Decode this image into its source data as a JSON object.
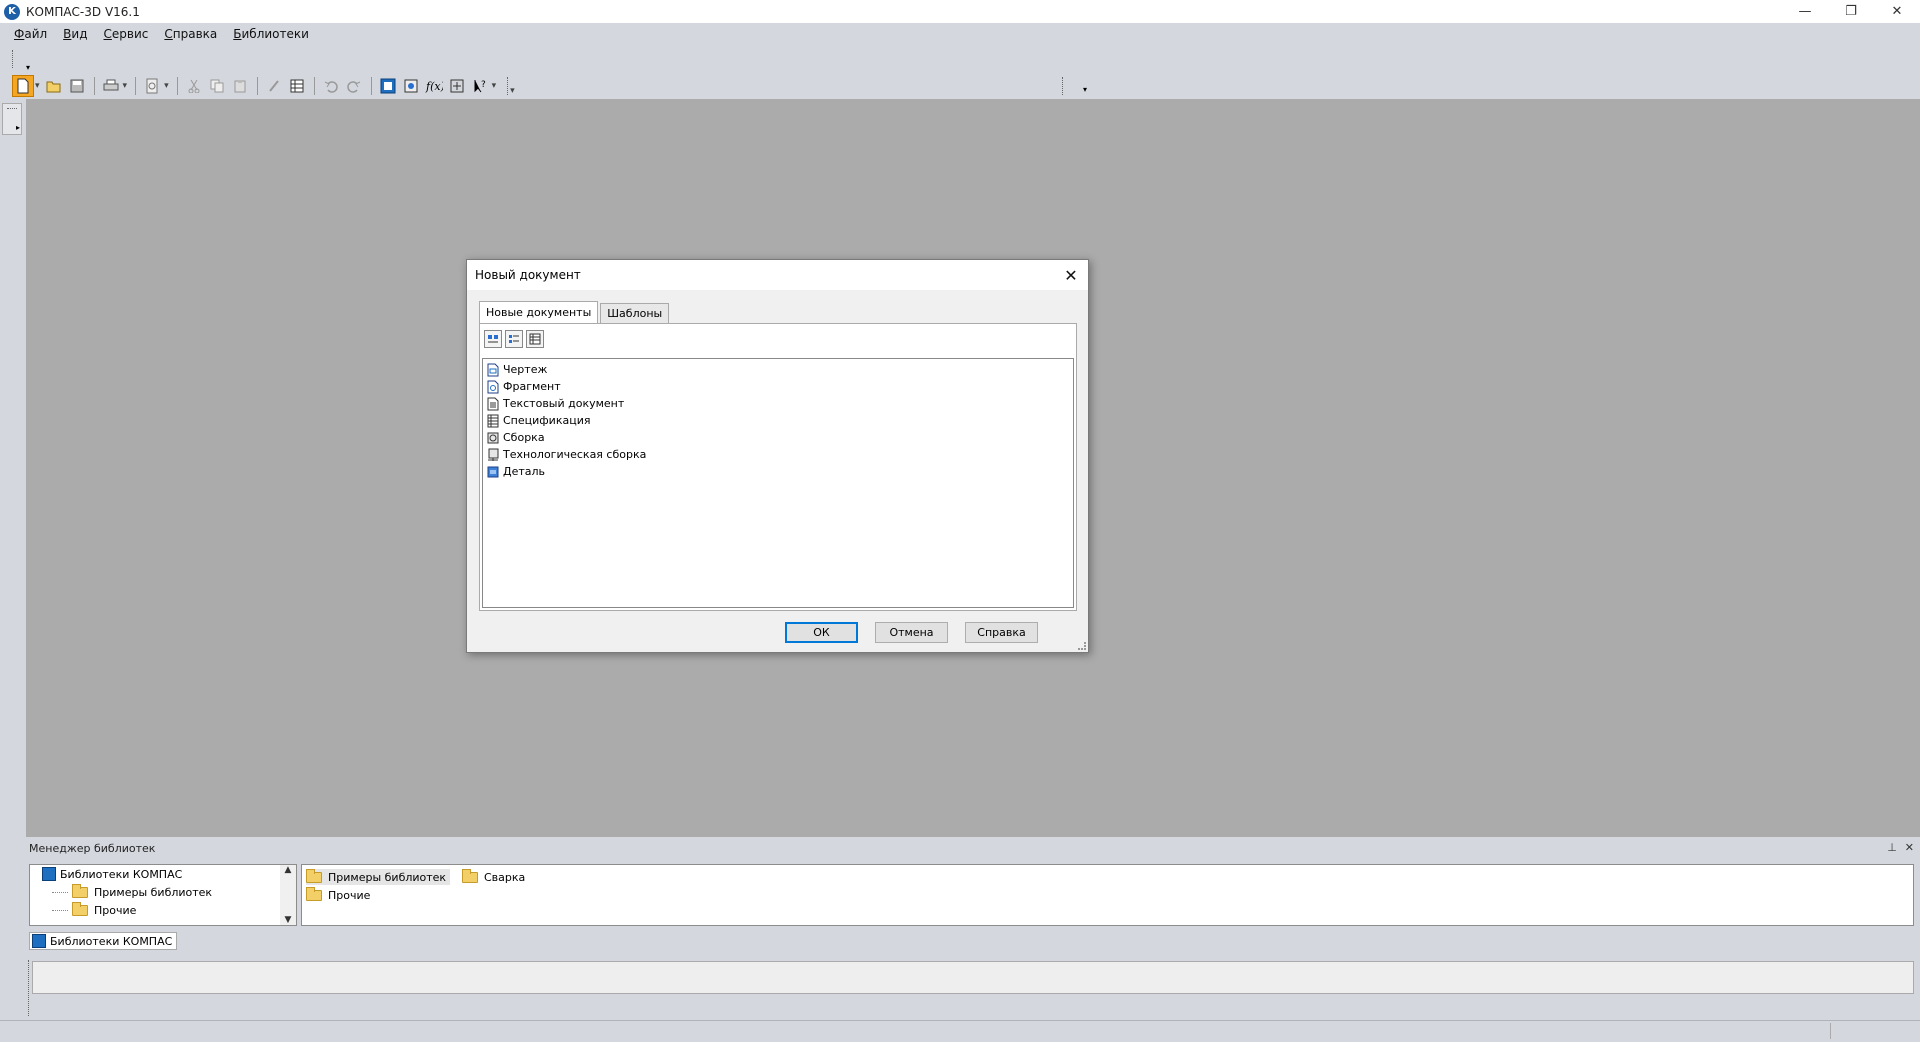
{
  "app": {
    "title": "КОМПАС-3D V16.1",
    "logo_letter": "K"
  },
  "window_controls": {
    "minimize": "—",
    "restore": "❐",
    "close": "✕"
  },
  "menu": [
    "Файл",
    "Вид",
    "Сервис",
    "Справка",
    "Библиотеки"
  ],
  "dialog": {
    "title": "Новый документ",
    "close": "✕",
    "tabs": [
      "Новые документы",
      "Шаблоны"
    ],
    "documents": [
      {
        "label": "Чертеж",
        "icon": "drawing-icon"
      },
      {
        "label": "Фрагмент",
        "icon": "fragment-icon"
      },
      {
        "label": "Текстовый документ",
        "icon": "text-document-icon"
      },
      {
        "label": "Спецификация",
        "icon": "specification-icon"
      },
      {
        "label": "Сборка",
        "icon": "assembly-icon"
      },
      {
        "label": "Технологическая сборка",
        "icon": "tech-assembly-icon"
      },
      {
        "label": "Деталь",
        "icon": "part-icon"
      }
    ],
    "buttons": {
      "ok": "ОК",
      "cancel": "Отмена",
      "help": "Справка"
    }
  },
  "library_manager": {
    "title": "Менеджер библиотек",
    "pin": "⊥",
    "close": "✕",
    "tree": [
      {
        "label": "Библиотеки КОМПАС",
        "level": 0
      },
      {
        "label": "Примеры библиотек",
        "level": 1
      },
      {
        "label": "Прочие",
        "level": 1
      }
    ],
    "content": [
      {
        "label": "Примеры библиотек",
        "selected": true
      },
      {
        "label": "Сварка",
        "selected": false
      },
      {
        "label": "Прочие",
        "selected": false
      }
    ],
    "tab_label": "Библиотеки КОМПАС"
  },
  "colors": {
    "accent": "#0078d7",
    "active_tool": "#f5a623",
    "workspace": "#ababab"
  }
}
